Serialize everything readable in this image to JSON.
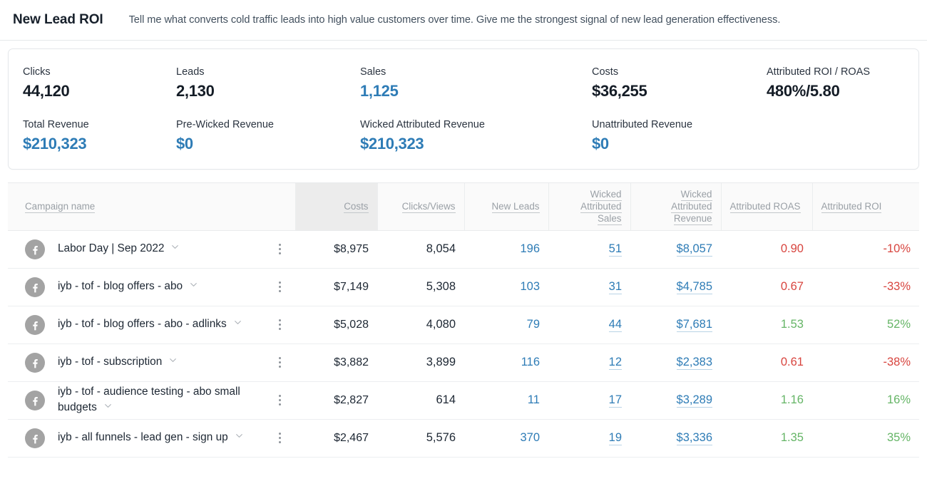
{
  "header": {
    "title": "New Lead ROI",
    "question": "Tell me what converts cold traffic leads into high value customers over time.  Give me the strongest signal of new lead generation effectiveness."
  },
  "colors": {
    "blue": "#2e7cb6",
    "positive": "#65b566",
    "negative": "#d8453f",
    "muted": "#9aa0a6",
    "sorted_header_bg": "#ececec"
  },
  "kpi": {
    "row1": [
      {
        "label": "Clicks",
        "value": "44,120",
        "style": "dark"
      },
      {
        "label": "Leads",
        "value": "2,130",
        "style": "dark"
      },
      {
        "label": "Sales",
        "value": "1,125",
        "style": "blue"
      },
      {
        "label": "Costs",
        "value": "$36,255",
        "style": "dark"
      },
      {
        "label": "Attributed ROI / ROAS",
        "value": "480%/5.80",
        "style": "dark"
      }
    ],
    "row2": [
      {
        "label": "Total Revenue",
        "value": "$210,323",
        "style": "blue"
      },
      {
        "label": "Pre-Wicked Revenue",
        "value": "$0",
        "style": "blue"
      },
      {
        "label": "Wicked Attributed Revenue",
        "value": "$210,323",
        "style": "blue"
      },
      {
        "label": "Unattributed Revenue",
        "value": "$0",
        "style": "blue"
      }
    ]
  },
  "table": {
    "columns": [
      {
        "key": "campaign",
        "label": "Campaign name",
        "align": "left",
        "sorted": false
      },
      {
        "key": "costs",
        "label": "Costs",
        "align": "right",
        "sorted": true
      },
      {
        "key": "clicks",
        "label": "Clicks/Views",
        "align": "right",
        "sorted": false
      },
      {
        "key": "new_leads",
        "label": "New Leads",
        "align": "right",
        "sorted": false
      },
      {
        "key": "wicked_sales",
        "label": "Wicked Attributed Sales",
        "align": "right",
        "sorted": false
      },
      {
        "key": "wicked_revenue",
        "label": "Wicked Attributed Revenue",
        "align": "right",
        "sorted": false
      },
      {
        "key": "roas",
        "label": "Attributed ROAS",
        "align": "left",
        "sorted": false
      },
      {
        "key": "roi",
        "label": "Attributed ROI",
        "align": "left",
        "sorted": false
      }
    ],
    "rows": [
      {
        "platform_icon": "facebook-icon",
        "campaign": "Labor Day | Sep 2022",
        "costs": "$8,975",
        "clicks": "8,054",
        "new_leads": "196",
        "wicked_sales": "51",
        "wicked_revenue": "$8,057",
        "roas": "0.90",
        "roas_sign": "negative",
        "roi": "-10%",
        "roi_sign": "negative"
      },
      {
        "platform_icon": "facebook-icon",
        "campaign": "iyb - tof - blog offers - abo",
        "costs": "$7,149",
        "clicks": "5,308",
        "new_leads": "103",
        "wicked_sales": "31",
        "wicked_revenue": "$4,785",
        "roas": "0.67",
        "roas_sign": "negative",
        "roi": "-33%",
        "roi_sign": "negative"
      },
      {
        "platform_icon": "facebook-icon",
        "campaign": "iyb - tof - blog offers - abo - adlinks",
        "costs": "$5,028",
        "clicks": "4,080",
        "new_leads": "79",
        "wicked_sales": "44",
        "wicked_revenue": "$7,681",
        "roas": "1.53",
        "roas_sign": "positive",
        "roi": "52%",
        "roi_sign": "positive"
      },
      {
        "platform_icon": "facebook-icon",
        "campaign": "iyb - tof - subscription",
        "costs": "$3,882",
        "clicks": "3,899",
        "new_leads": "116",
        "wicked_sales": "12",
        "wicked_revenue": "$2,383",
        "roas": "0.61",
        "roas_sign": "negative",
        "roi": "-38%",
        "roi_sign": "negative"
      },
      {
        "platform_icon": "facebook-icon",
        "campaign": "iyb - tof - audience testing - abo small budgets",
        "costs": "$2,827",
        "clicks": "614",
        "new_leads": "11",
        "wicked_sales": "17",
        "wicked_revenue": "$3,289",
        "roas": "1.16",
        "roas_sign": "positive",
        "roi": "16%",
        "roi_sign": "positive"
      },
      {
        "platform_icon": "facebook-icon",
        "campaign": "iyb - all funnels - lead gen - sign up",
        "costs": "$2,467",
        "clicks": "5,576",
        "new_leads": "370",
        "wicked_sales": "19",
        "wicked_revenue": "$3,336",
        "roas": "1.35",
        "roas_sign": "positive",
        "roi": "35%",
        "roi_sign": "positive"
      }
    ]
  }
}
